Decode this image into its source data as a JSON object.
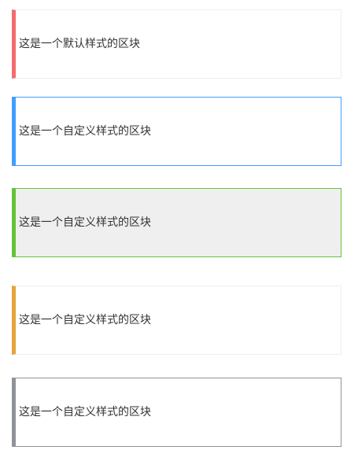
{
  "blocks": [
    {
      "text": "这是一个默认样式的区块",
      "accent_color": "#f56c6c",
      "border_color": "#ebeef5",
      "background": "#ffffff"
    },
    {
      "text": "这是一个自定义样式的区块",
      "accent_color": "#409eff",
      "border_color": "#409eff",
      "background": "#ffffff"
    },
    {
      "text": "这是一个自定义样式的区块",
      "accent_color": "#67c23a",
      "border_color": "#67c23a",
      "background": "#efefef"
    },
    {
      "text": "这是一个自定义样式的区块",
      "accent_color": "#e6a23c",
      "border_color": "#ebeef5",
      "background": "#ffffff"
    },
    {
      "text": "这是一个自定义样式的区块",
      "accent_color": "#909399",
      "border_color": "#909399",
      "background": "#ffffff"
    }
  ]
}
